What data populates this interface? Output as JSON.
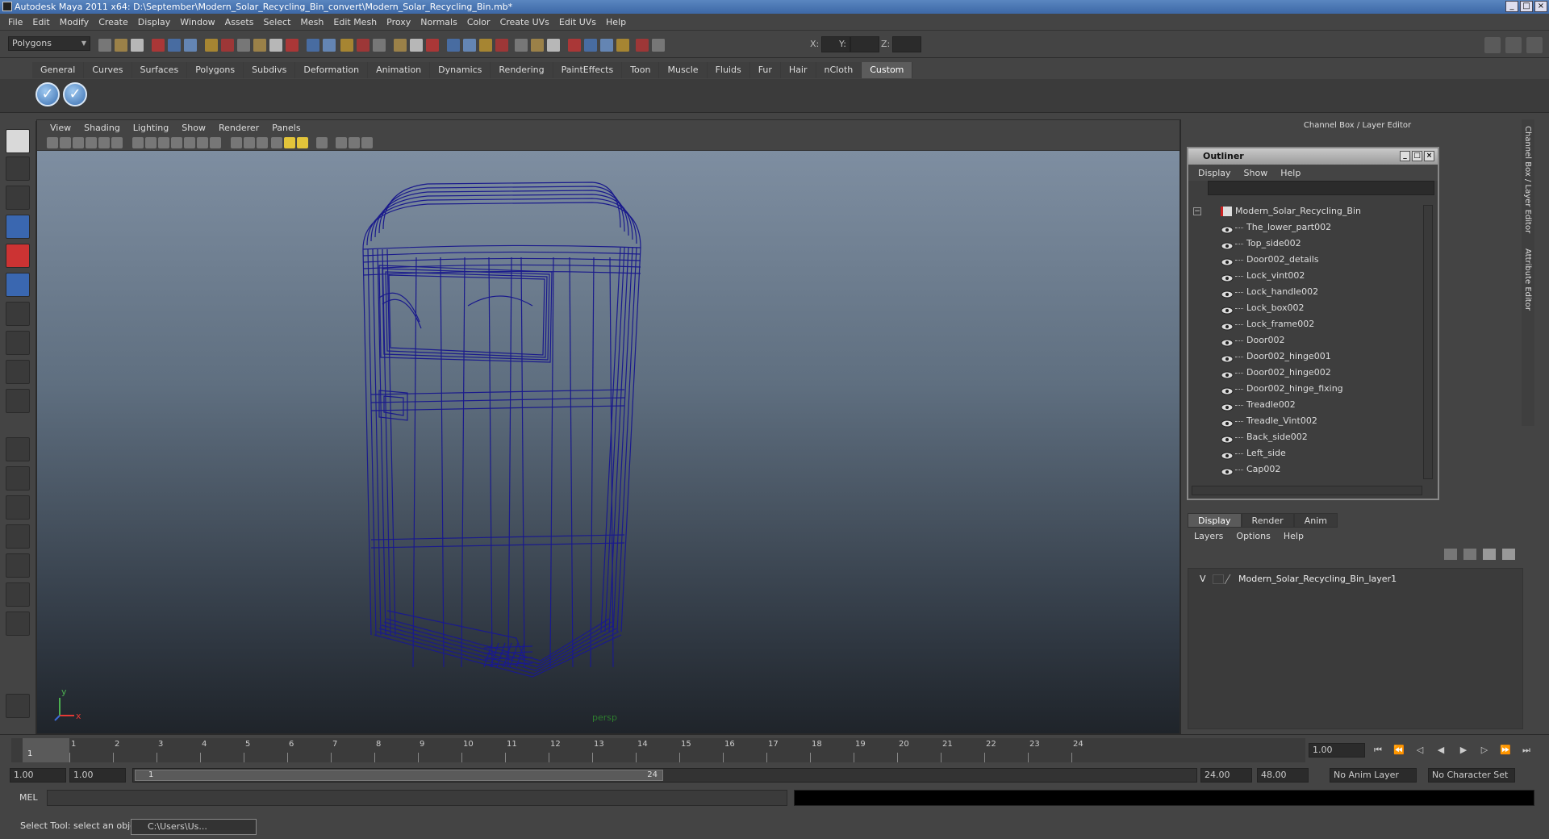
{
  "window": {
    "title": "Autodesk Maya 2011 x64: D:\\September\\Modern_Solar_Recycling_Bin_convert\\Modern_Solar_Recycling_Bin.mb*"
  },
  "menubar": [
    "File",
    "Edit",
    "Modify",
    "Create",
    "Display",
    "Window",
    "Assets",
    "Select",
    "Mesh",
    "Edit Mesh",
    "Proxy",
    "Normals",
    "Color",
    "Create UVs",
    "Edit UVs",
    "Help"
  ],
  "statusline": {
    "mode": "Polygons",
    "x_label": "X:",
    "y_label": "Y:",
    "z_label": "Z:"
  },
  "shelf": {
    "tabs": [
      "General",
      "Curves",
      "Surfaces",
      "Polygons",
      "Subdivs",
      "Deformation",
      "Animation",
      "Dynamics",
      "Rendering",
      "PaintEffects",
      "Toon",
      "Muscle",
      "Fluids",
      "Fur",
      "Hair",
      "nCloth",
      "Custom"
    ],
    "active_tab": "Custom",
    "buttons": [
      "check-icon",
      "check-icon"
    ]
  },
  "viewport": {
    "menu": [
      "View",
      "Shading",
      "Lighting",
      "Show",
      "Renderer",
      "Panels"
    ],
    "camera_label": "persp",
    "axis_x": "x",
    "axis_y": "y",
    "wire_color": "#1a1a8c"
  },
  "channelbox": {
    "header": "Channel Box / Layer Editor",
    "side_tabs": [
      "Channel Box / Layer Editor",
      "Attribute Editor"
    ]
  },
  "outliner": {
    "title": "Outliner",
    "menu": [
      "Display",
      "Show",
      "Help"
    ],
    "root": "Modern_Solar_Recycling_Bin",
    "items": [
      "The_lower_part002",
      "Top_side002",
      "Door002_details",
      "Lock_vint002",
      "Lock_handle002",
      "Lock_box002",
      "Lock_frame002",
      "Door002",
      "Door002_hinge001",
      "Door002_hinge002",
      "Door002_hinge_fixing",
      "Treadle002",
      "Treadle_Vint002",
      "Back_side002",
      "Left_side",
      "Cap002"
    ]
  },
  "layers": {
    "tabs": [
      "Display",
      "Render",
      "Anim"
    ],
    "active_tab": "Display",
    "menu": [
      "Layers",
      "Options",
      "Help"
    ],
    "visibility": "V",
    "layer_name": "Modern_Solar_Recycling_Bin_layer1"
  },
  "timeline": {
    "ticks": [
      "1",
      "2",
      "3",
      "4",
      "5",
      "6",
      "7",
      "8",
      "9",
      "10",
      "11",
      "12",
      "13",
      "14",
      "15",
      "16",
      "17",
      "18",
      "19",
      "20",
      "21",
      "22",
      "23",
      "24"
    ],
    "current_frame_marker": "1",
    "current_frame": "1.00"
  },
  "range": {
    "start": "1.00",
    "start2": "1.00",
    "handle_start": "1",
    "handle_end": "24",
    "end": "24.00",
    "end2": "48.00",
    "anim_layer": "No Anim Layer",
    "char_set": "No Character Set"
  },
  "cmdline": {
    "label": "MEL"
  },
  "helpline": {
    "text": "Select Tool: select an object",
    "task": "C:\\Users\\Us..."
  }
}
